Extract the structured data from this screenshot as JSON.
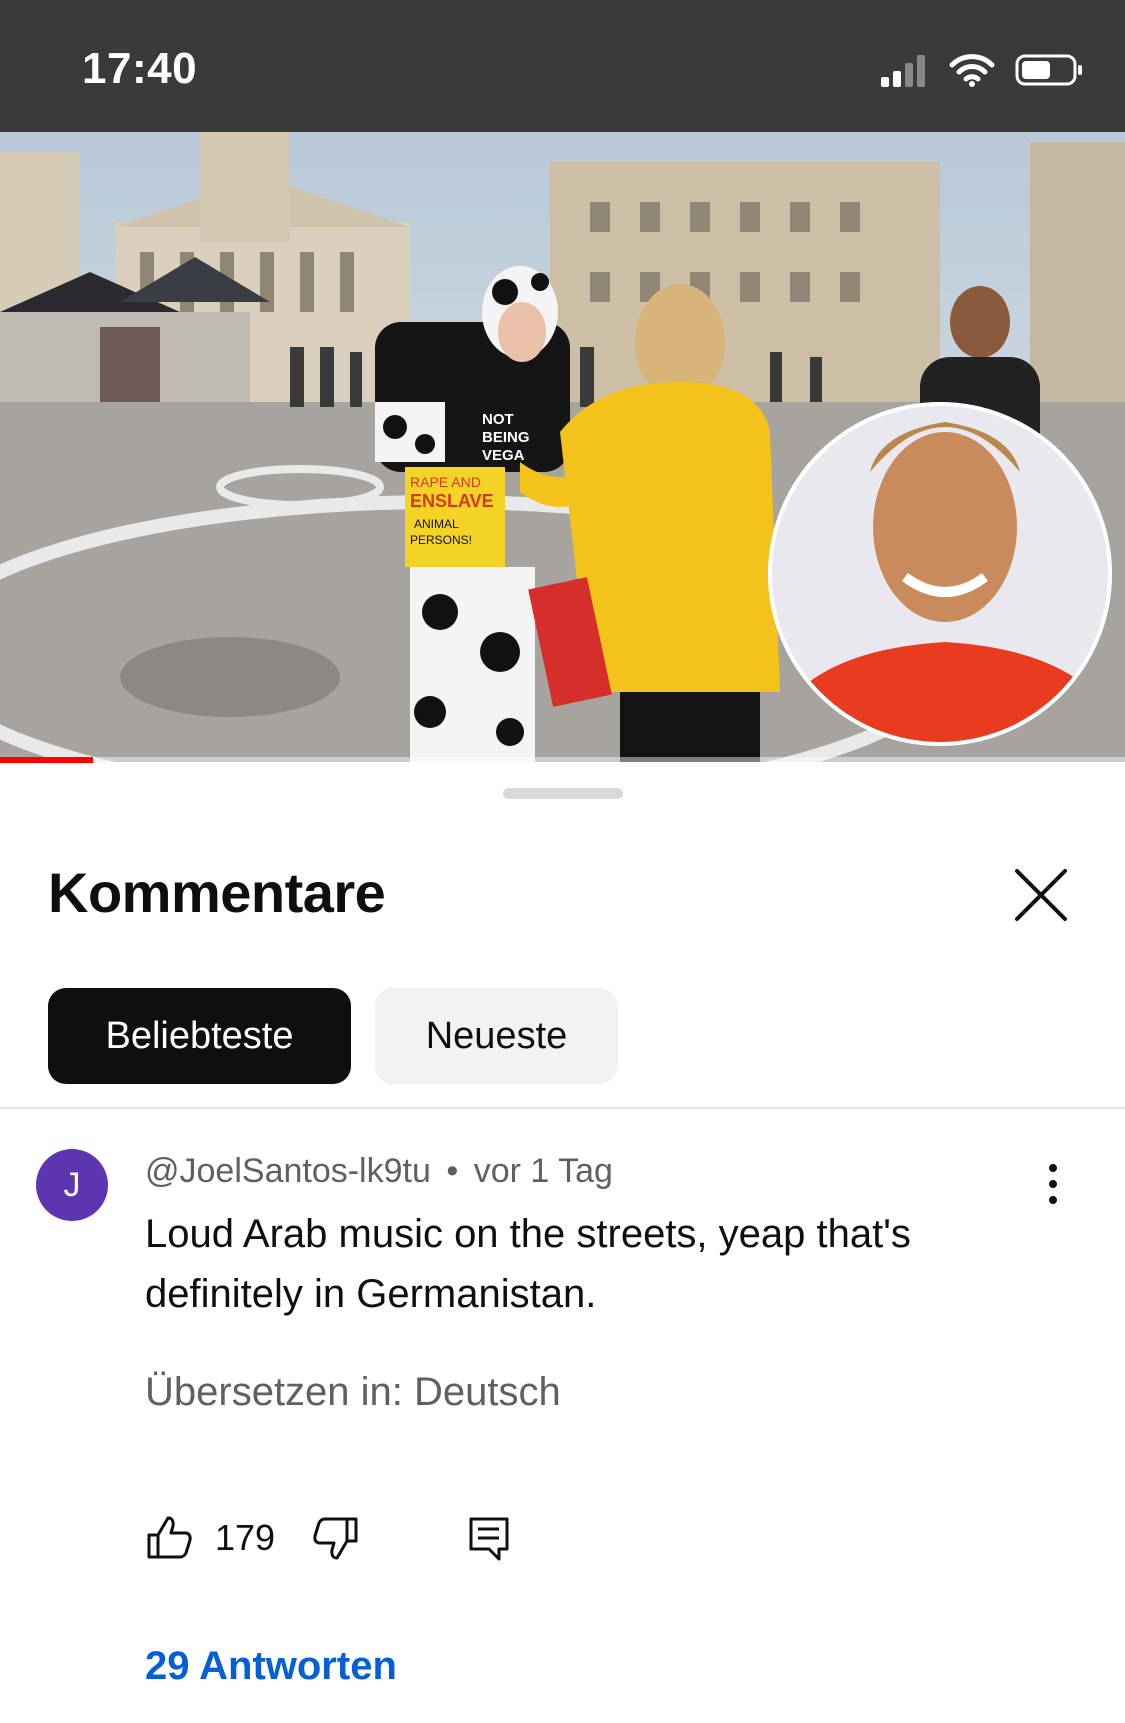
{
  "status_bar": {
    "time": "17:40"
  },
  "video": {
    "progress": 0.083,
    "progress_color": "#ff0000"
  },
  "comments_sheet": {
    "title": "Kommentare",
    "filters": {
      "active": "Beliebteste",
      "inactive": "Neueste"
    },
    "comment": {
      "avatar_letter": "J",
      "avatar_color": "#5e35b1",
      "author": "@JoelSantos-lk9tu",
      "separator": "•",
      "time": "vor 1 Tag",
      "text": "Loud Arab music on the streets, yeap that's definitely in Germanistan.",
      "translate": "Übersetzen in: Deutsch",
      "likes": "179",
      "replies": "29 Antworten"
    }
  },
  "icons": {
    "status": [
      "cellular-signal-icon",
      "wifi-icon",
      "battery-icon"
    ],
    "actions": [
      "thumbs-up-icon",
      "thumbs-down-icon",
      "reply-comment-icon",
      "more-vertical-icon",
      "close-icon"
    ]
  }
}
